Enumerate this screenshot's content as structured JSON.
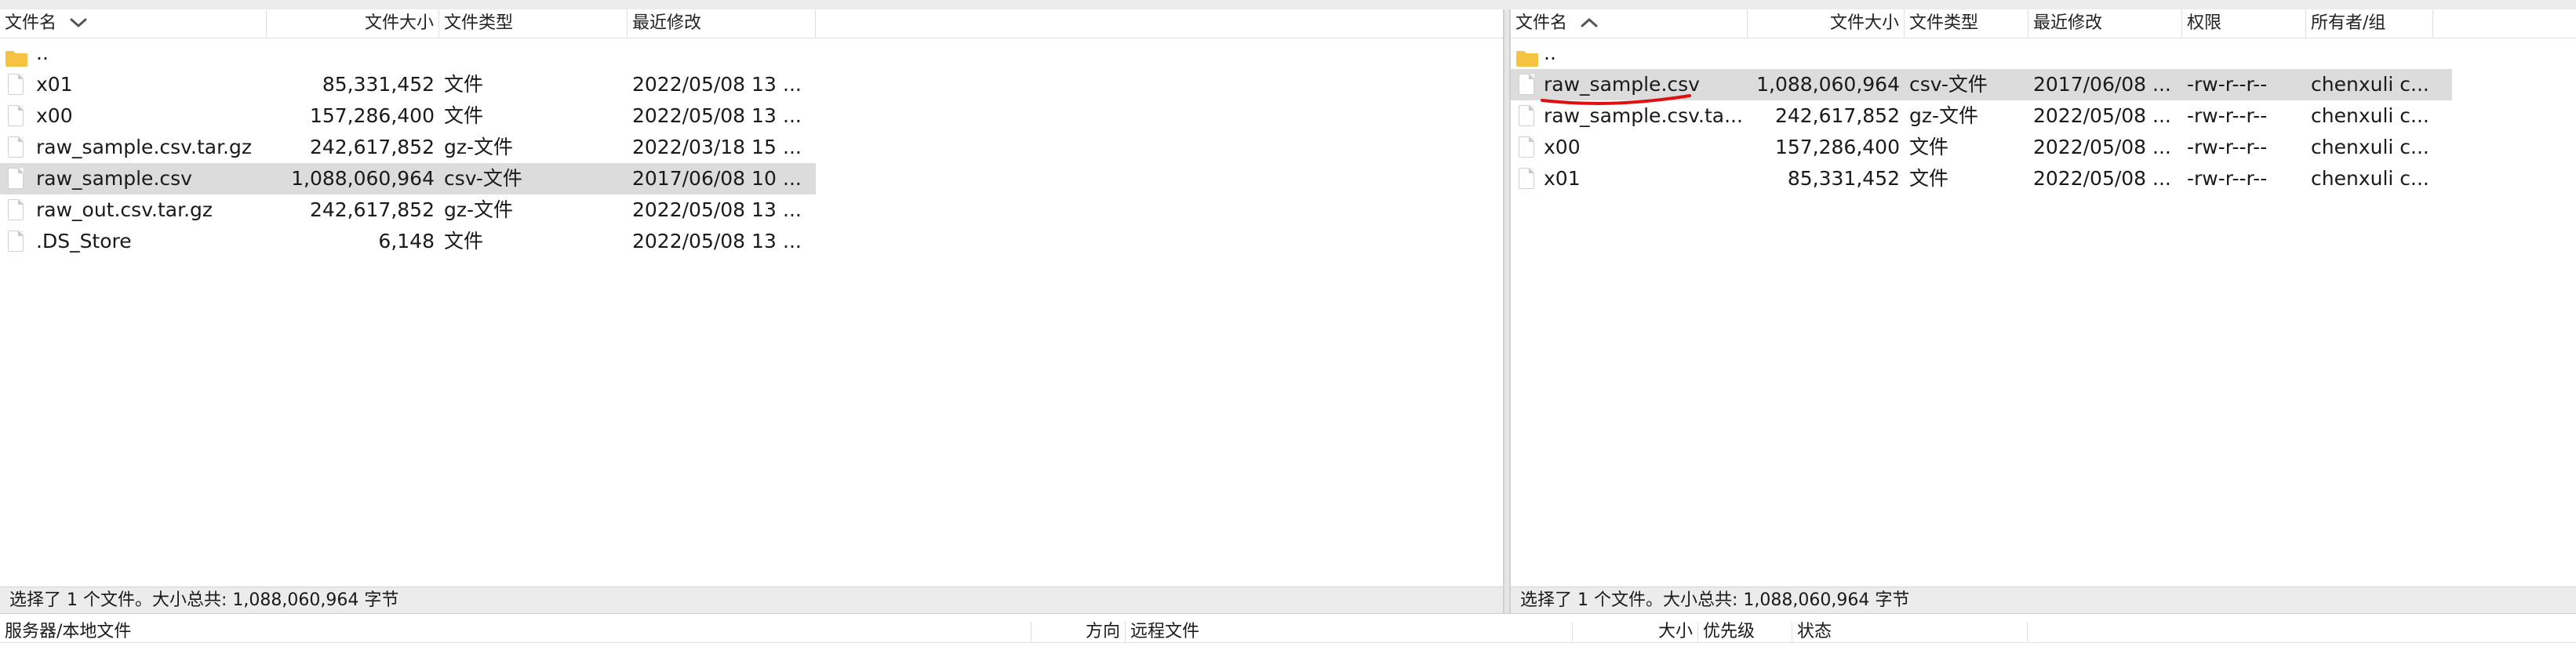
{
  "left_pane": {
    "columns": {
      "name": "文件名",
      "size": "文件大小",
      "type": "文件类型",
      "modified": "最近修改"
    },
    "rows": [
      {
        "name": "..",
        "size": "",
        "type": "",
        "modified": "",
        "more": "",
        "folder": true,
        "selected": false
      },
      {
        "name": "x01",
        "size": "85,331,452",
        "type": "文件",
        "modified": "2022/05/08 13",
        "more": "...",
        "folder": false,
        "selected": false
      },
      {
        "name": "x00",
        "size": "157,286,400",
        "type": "文件",
        "modified": "2022/05/08 13",
        "more": "...",
        "folder": false,
        "selected": false
      },
      {
        "name": "raw_sample.csv.tar.gz",
        "size": "242,617,852",
        "type": "gz-文件",
        "modified": "2022/03/18 15",
        "more": "...",
        "folder": false,
        "selected": false
      },
      {
        "name": "raw_sample.csv",
        "size": "1,088,060,964",
        "type": "csv-文件",
        "modified": "2017/06/08 10",
        "more": "...",
        "folder": false,
        "selected": true
      },
      {
        "name": "raw_out.csv.tar.gz",
        "size": "242,617,852",
        "type": "gz-文件",
        "modified": "2022/05/08 13",
        "more": "...",
        "folder": false,
        "selected": false
      },
      {
        "name": ".DS_Store",
        "size": "6,148",
        "type": "文件",
        "modified": "2022/05/08 13",
        "more": "...",
        "folder": false,
        "selected": false
      }
    ],
    "status": "选择了 1 个文件。大小总共: 1,088,060,964 字节"
  },
  "right_pane": {
    "columns": {
      "name": "文件名",
      "size": "文件大小",
      "type": "文件类型",
      "modified": "最近修改",
      "permissions": "权限",
      "owner": "所有者/组"
    },
    "rows": [
      {
        "name": "..",
        "size": "",
        "type": "",
        "modified": "",
        "more": "",
        "permissions": "",
        "owner": "",
        "folder": true,
        "selected": false
      },
      {
        "name": "raw_sample.csv",
        "size": "1,088,060,964",
        "type": "csv-文件",
        "modified": "2017/06/08",
        "more": "...",
        "permissions": "-rw-r--r--",
        "owner": "chenxuli c...",
        "folder": false,
        "selected": true
      },
      {
        "name": "raw_sample.csv.ta...",
        "size": "242,617,852",
        "type": "gz-文件",
        "modified": "2022/05/08",
        "more": "...",
        "permissions": "-rw-r--r--",
        "owner": "chenxuli c...",
        "folder": false,
        "selected": false
      },
      {
        "name": "x00",
        "size": "157,286,400",
        "type": "文件",
        "modified": "2022/05/08",
        "more": "...",
        "permissions": "-rw-r--r--",
        "owner": "chenxuli c...",
        "folder": false,
        "selected": false
      },
      {
        "name": "x01",
        "size": "85,331,452",
        "type": "文件",
        "modified": "2022/05/08",
        "more": "...",
        "permissions": "-rw-r--r--",
        "owner": "chenxuli c...",
        "folder": false,
        "selected": false
      }
    ],
    "status": "选择了 1 个文件。大小总共: 1,088,060,964 字节"
  },
  "queue": {
    "columns": {
      "server": "服务器/本地文件",
      "direction": "方向",
      "remote": "远程文件",
      "size": "大小",
      "priority": "优先级",
      "status": "状态"
    }
  },
  "colors": {
    "selection": "#dcdcdc",
    "annotation": "#e01010",
    "folder": "#f5c242"
  }
}
